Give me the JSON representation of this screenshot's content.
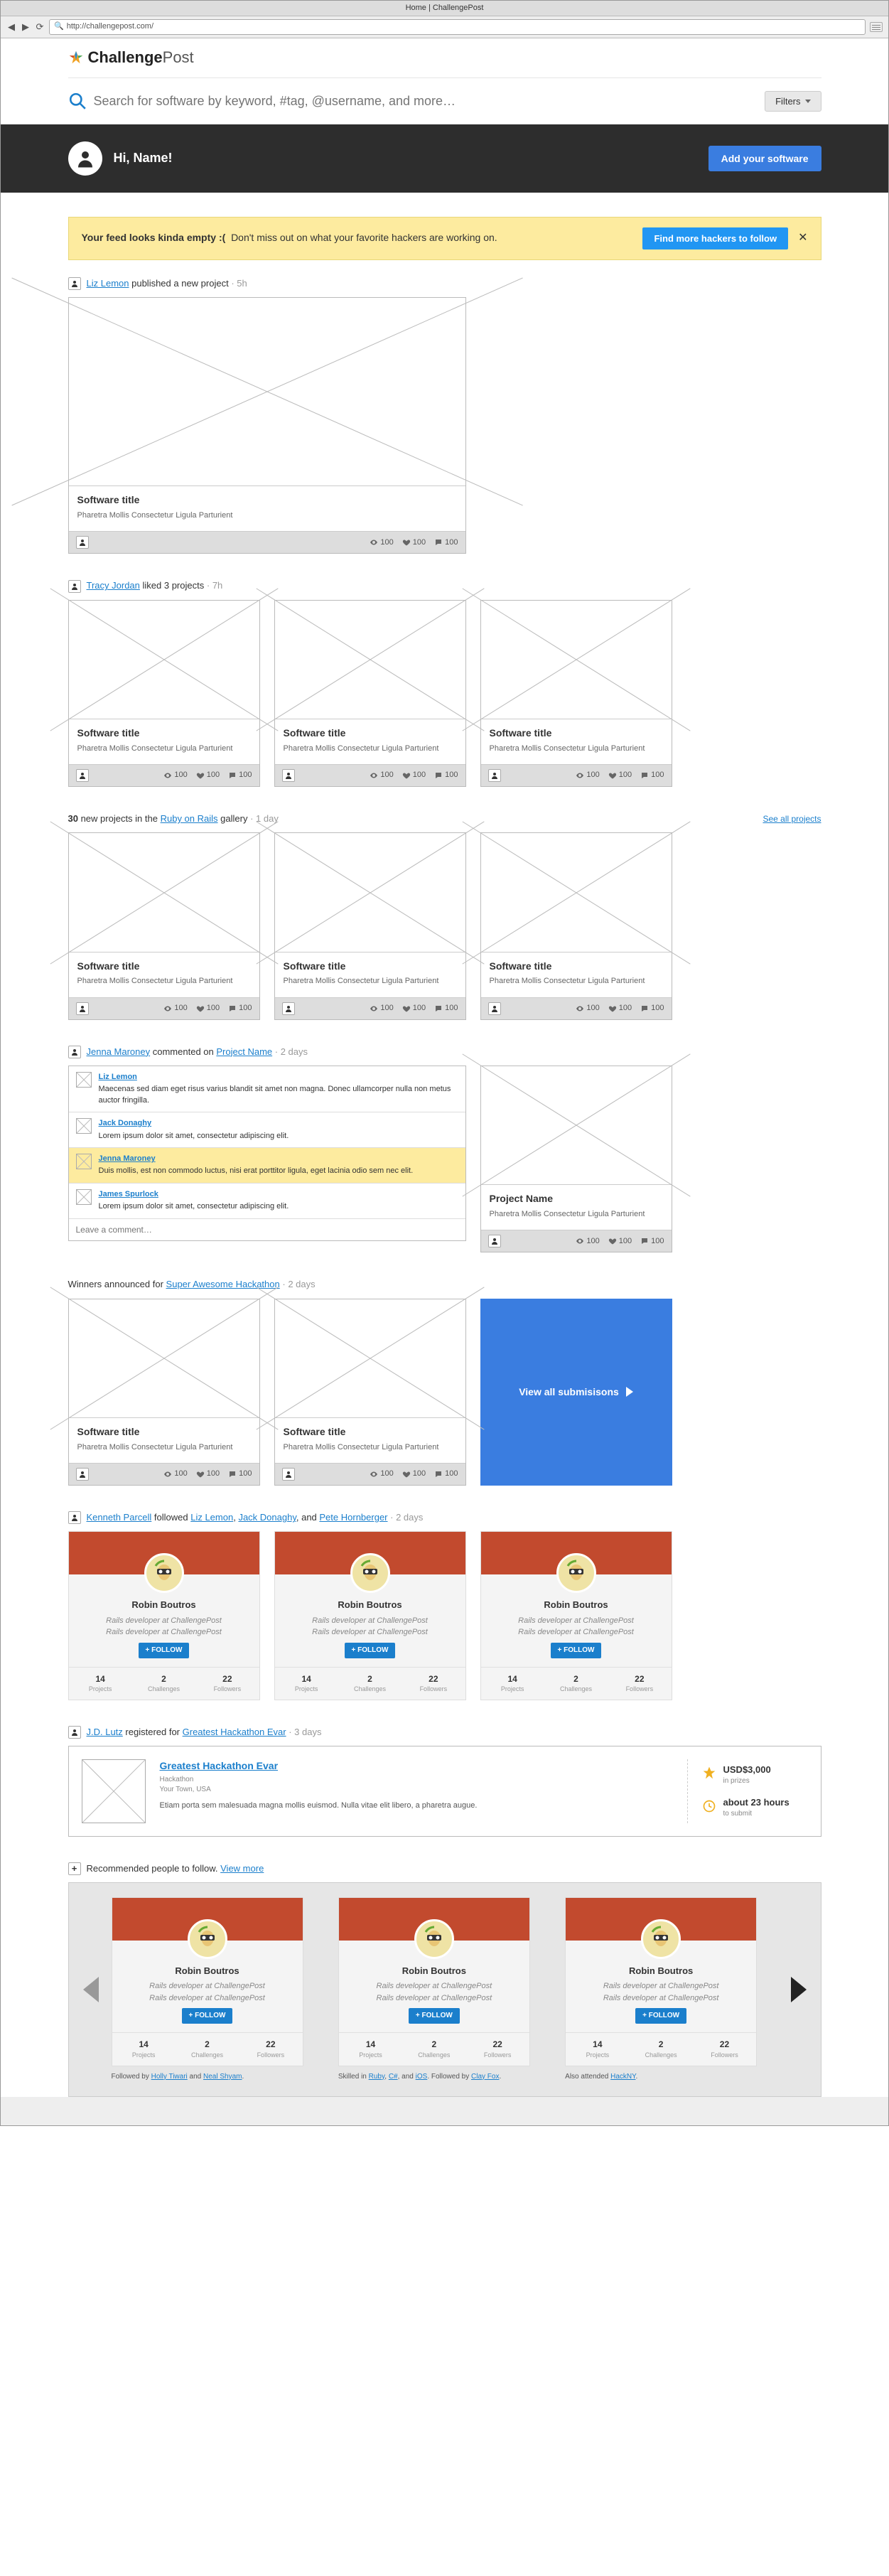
{
  "browser": {
    "title": "Home | ChallengePost",
    "url": "http://challengepost.com/"
  },
  "header": {
    "logo_a": "Challenge",
    "logo_b": "Post",
    "search_placeholder": "Search for software by keyword, #tag, @username, and more…",
    "filters_label": "Filters"
  },
  "hero": {
    "greeting": "Hi, Name!",
    "cta": "Add your software"
  },
  "banner": {
    "bold": "Your feed looks kinda empty :(",
    "rest": "Don't miss out on what your favorite hackers are working on.",
    "cta": "Find more hackers to follow"
  },
  "feed": {
    "item1": {
      "user": "Liz Lemon",
      "action": "published a new project",
      "time": "5h",
      "card": {
        "title": "Software title",
        "sub": "Pharetra Mollis Consectetur Ligula Parturient",
        "views": "100",
        "likes": "100",
        "comments": "100"
      }
    },
    "item2": {
      "user": "Tracy Jordan",
      "action": "liked 3 projects",
      "time": "7h",
      "cards": [
        {
          "title": "Software title",
          "sub": "Pharetra Mollis Consectetur Ligula Parturient",
          "views": "100",
          "likes": "100",
          "comments": "100"
        },
        {
          "title": "Software title",
          "sub": "Pharetra Mollis Consectetur Ligula Parturient",
          "views": "100",
          "likes": "100",
          "comments": "100"
        },
        {
          "title": "Software title",
          "sub": "Pharetra Mollis Consectetur Ligula Parturient",
          "views": "100",
          "likes": "100",
          "comments": "100"
        }
      ]
    },
    "item3": {
      "prefix": "30",
      "mid": " new projects in the ",
      "link": "Ruby on Rails",
      "suffix": " gallery",
      "time": "1 day",
      "see_all": "See all projects",
      "cards": [
        {
          "title": "Software title",
          "sub": "Pharetra Mollis Consectetur Ligula Parturient",
          "views": "100",
          "likes": "100",
          "comments": "100"
        },
        {
          "title": "Software title",
          "sub": "Pharetra Mollis Consectetur Ligula Parturient",
          "views": "100",
          "likes": "100",
          "comments": "100"
        },
        {
          "title": "Software title",
          "sub": "Pharetra Mollis Consectetur Ligula Parturient",
          "views": "100",
          "likes": "100",
          "comments": "100"
        }
      ]
    },
    "item4": {
      "user": "Jenna Maroney",
      "action": "commented on",
      "link": "Project Name",
      "time": "2 days",
      "comments": [
        {
          "name": "Liz Lemon",
          "text": "Maecenas sed diam eget risus varius blandit sit amet non magna. Donec ullamcorper nulla non metus auctor fringilla.",
          "hl": false
        },
        {
          "name": "Jack Donaghy",
          "text": "Lorem ipsum dolor sit amet, consectetur adipiscing elit.",
          "hl": false
        },
        {
          "name": "Jenna Maroney",
          "text": "Duis mollis, est non commodo luctus, nisi erat porttitor ligula, eget lacinia odio sem nec elit.",
          "hl": true
        },
        {
          "name": "James Spurlock",
          "text": "Lorem ipsum dolor sit amet, consectetur adipiscing elit.",
          "hl": false
        }
      ],
      "input_placeholder": "Leave a comment…",
      "card": {
        "title": "Project Name",
        "sub": "Pharetra Mollis Consectetur Ligula Parturient",
        "views": "100",
        "likes": "100",
        "comments": "100"
      }
    },
    "item5": {
      "prefix": "Winners announced",
      "mid": " for ",
      "link": "Super Awesome Hackathon",
      "time": "2 days",
      "cards": [
        {
          "title": "Software title",
          "sub": "Pharetra Mollis Consectetur Ligula Parturient",
          "views": "100",
          "likes": "100",
          "comments": "100"
        },
        {
          "title": "Software title",
          "sub": "Pharetra Mollis Consectetur Ligula Parturient",
          "views": "100",
          "likes": "100",
          "comments": "100"
        }
      ],
      "cta": "View all submisisons"
    },
    "item6": {
      "user": "Kenneth Parcell",
      "action": "followed ",
      "u1": "Liz Lemon",
      "u2": "Jack Donaghy",
      "and": ", and ",
      "u3": "Pete Hornberger",
      "time": "2 days",
      "role1": "Rails developer at ChallengePost",
      "role2": "Rails developer at ChallengePost",
      "follow": "+ FOLLOW",
      "stats": {
        "p": "14",
        "pl": "Projects",
        "c": "2",
        "cl": "Challenges",
        "f": "22",
        "fl": "Followers"
      },
      "names": [
        "Robin Boutros",
        "Robin Boutros",
        "Robin Boutros"
      ]
    },
    "item7": {
      "user": "J.D. Lutz",
      "action": "registered for ",
      "link": "Greatest Hackathon Evar",
      "time": "3 days",
      "title": "Greatest Hackathon Evar",
      "type": "Hackathon",
      "loc": "Your Town, USA",
      "desc": "Etiam porta sem malesuada magna mollis euismod. Nulla vitae elit libero, a pharetra augue.",
      "prize_val": "USD$3,000",
      "prize_lbl": "in prizes",
      "time_val": "about 23 hours",
      "time_lbl": "to submit"
    },
    "item8": {
      "prefix": "Recommended people to follow. ",
      "link": "View more",
      "role1": "Rails developer at ChallengePost",
      "role2": "Rails developer at ChallengePost",
      "follow": "+ FOLLOW",
      "stats": {
        "p": "14",
        "pl": "Projects",
        "c": "2",
        "cl": "Challenges",
        "f": "22",
        "fl": "Followers"
      },
      "names": [
        "Robin Boutros",
        "Robin Boutros",
        "Robin Boutros"
      ],
      "notes": {
        "n0_a": "Followed by ",
        "n0_l1": "Holly Tiwari",
        "n0_b": " and ",
        "n0_l2": "Neal Shyam",
        "n0_c": ".",
        "n1_a": "Skilled in ",
        "n1_l1": "Ruby",
        "n1_b": ", ",
        "n1_l2": "C#",
        "n1_c": ", and ",
        "n1_l3": "iOS",
        "n1_d": ". Followed by ",
        "n1_l4": "Clay Fox",
        "n1_e": ".",
        "n2_a": "Also attended ",
        "n2_l1": "HackNY",
        "n2_b": "."
      }
    }
  }
}
